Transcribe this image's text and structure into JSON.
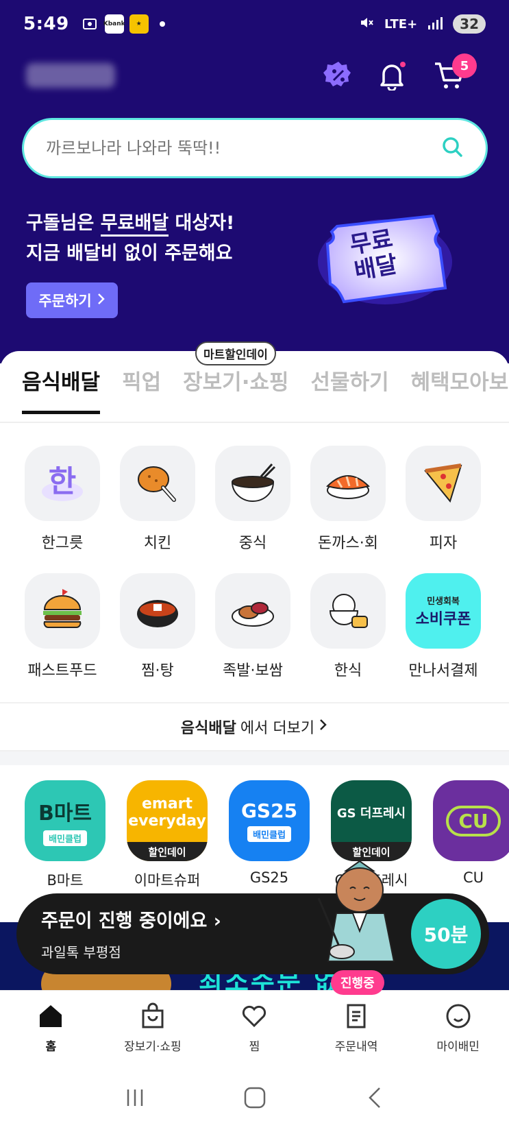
{
  "status_bar": {
    "time": "5:49",
    "icons": [
      "gallery-icon",
      "kbank-icon",
      "app-icon"
    ],
    "network": "LTE+",
    "battery": "32"
  },
  "header": {
    "cart_count": "5"
  },
  "search": {
    "placeholder": "까르보나라 나와라 뚝딱!!"
  },
  "promo": {
    "line1_prefix": "구돌님은 ",
    "line1_highlight": "무료배달",
    "line1_suffix": " 대상자!",
    "line2": "지금 배달비 없이 주문해요",
    "button": "주문하기",
    "ticket_line1": "무료",
    "ticket_line2": "배달"
  },
  "tabs": {
    "badge": "마트할인데이",
    "items": [
      "음식배달",
      "픽업",
      "장보기·쇼핑",
      "선물하기",
      "혜택모아보기"
    ]
  },
  "categories": [
    "한그릇",
    "치킨",
    "중식",
    "돈까스·회",
    "피자",
    "패스트푸드",
    "찜·탕",
    "족발·보쌈",
    "한식",
    "만나서결제"
  ],
  "coupon": {
    "line1": "민생회복",
    "line2": "소비쿠폰"
  },
  "more": {
    "bold": "음식배달",
    "rest": "에서 더보기"
  },
  "marts": [
    {
      "name": "B마트",
      "logo": "B마트",
      "strip": "배민클럽"
    },
    {
      "name": "이마트슈퍼",
      "logo": "emart everyday",
      "strip": "할인데이"
    },
    {
      "name": "GS25",
      "logo": "GS25",
      "strip": "배민클럽"
    },
    {
      "name": "GS더프레시",
      "logo": "GS 더프레시",
      "strip": "할인데이"
    },
    {
      "name": "CU",
      "logo": "CU",
      "strip": ""
    }
  ],
  "order_progress": {
    "title": "주문이 진행 중이에요",
    "store": "과일톡 부평점",
    "minutes": "50분",
    "status_pill": "진행중"
  },
  "banner": {
    "text": "최소주문 없는"
  },
  "bottom_nav": [
    "홈",
    "장보기·쇼핑",
    "찜",
    "주문내역",
    "마이배민"
  ],
  "colors": {
    "brand": "#1d0a72",
    "accent": "#2dd0c2",
    "pink": "#ff3b8e"
  }
}
